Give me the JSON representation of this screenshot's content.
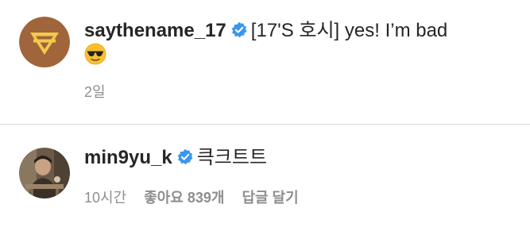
{
  "comments": [
    {
      "username": "saythename_17",
      "verified": true,
      "text": "[17'S 호시] yes! I’m bad",
      "emoji": "sunglasses-emoji",
      "time": "2일"
    },
    {
      "username": "min9yu_k",
      "verified": true,
      "text": "큭크트트",
      "time": "10시간",
      "likes": "좋아요 839개",
      "reply_label": "답글 달기"
    }
  ],
  "colors": {
    "primary_text": "#262626",
    "secondary_text": "#8e8e8e",
    "verified_blue": "#3897f0",
    "divider": "#dbdbdb",
    "avatar1_bg": "#a0653a",
    "avatar1_logo": "#f2c94c"
  }
}
